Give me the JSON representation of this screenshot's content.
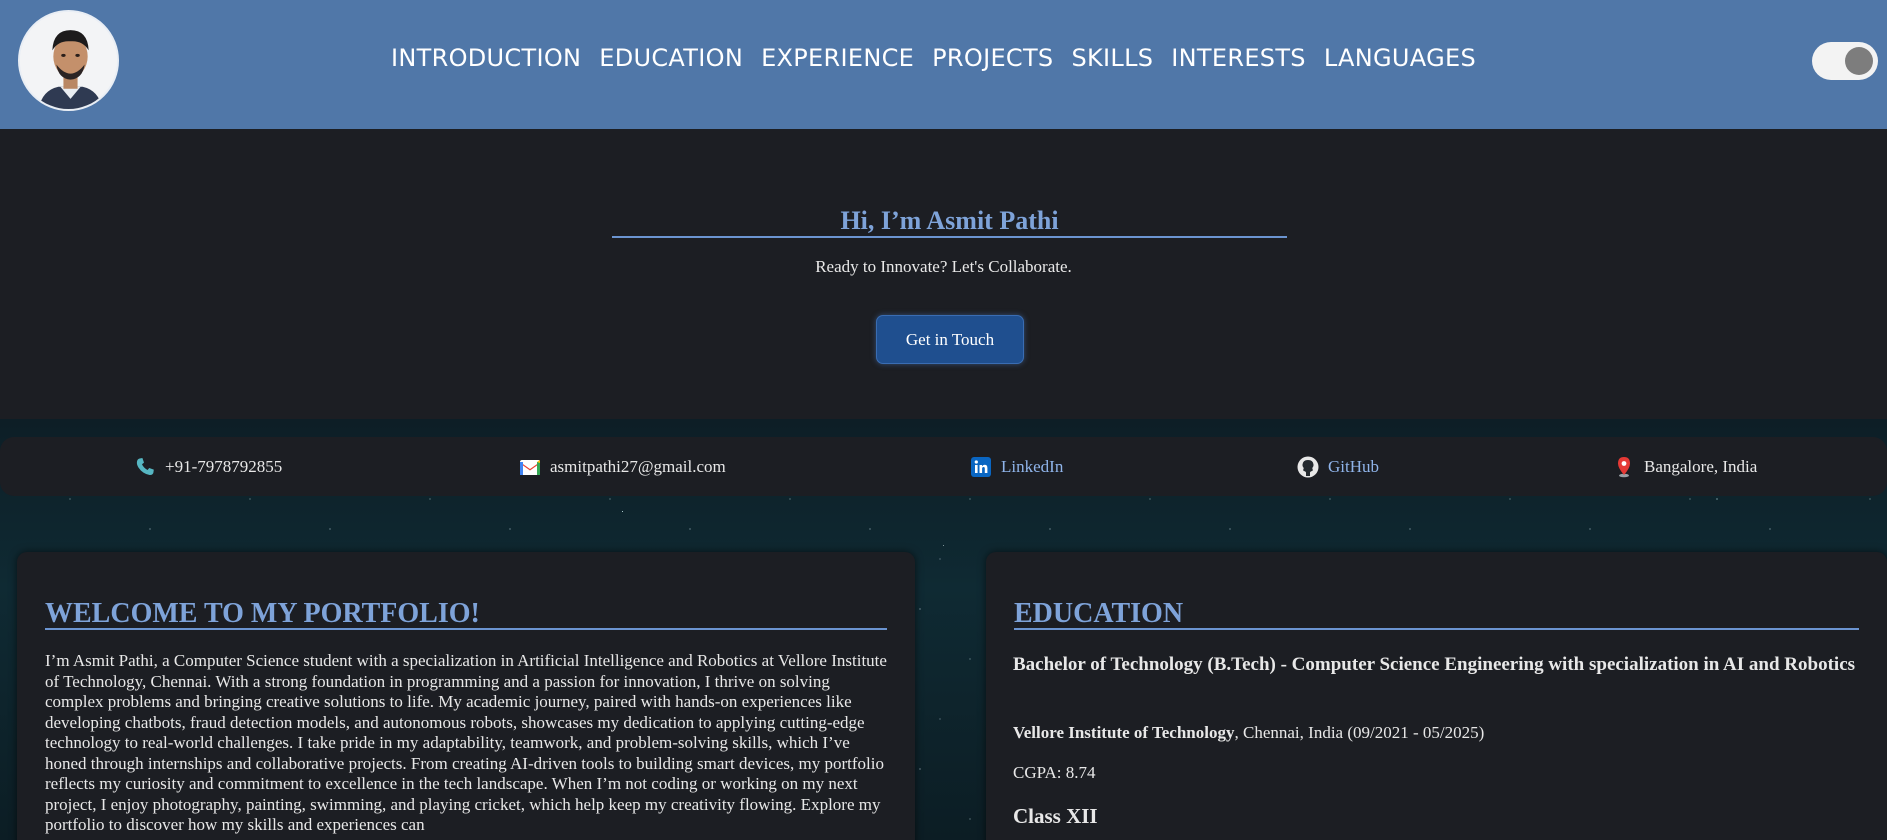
{
  "nav": {
    "items": [
      "INTRODUCTION",
      "EDUCATION",
      "EXPERIENCE",
      "PROJECTS",
      "SKILLS",
      "INTERESTS",
      "LANGUAGES"
    ]
  },
  "hero": {
    "title": "Hi, I’m Asmit Pathi",
    "subtitle": "Ready to Innovate? Let's Collaborate.",
    "cta_label": "Get in Touch"
  },
  "contacts": {
    "phone": "+91-7978792855",
    "email": "asmitpathi27@gmail.com",
    "linkedin": "LinkedIn",
    "github": "GitHub",
    "location": "Bangalore, India"
  },
  "intro": {
    "heading": "WELCOME TO MY PORTFOLIO!",
    "body": "I’m Asmit Pathi, a Computer Science student with a specialization in Artificial Intelligence and Robotics at Vellore Institute of Technology, Chennai. With a strong foundation in programming and a passion for innovation, I thrive on solving complex problems and bringing creative solutions to life. My academic journey, paired with hands-on experiences like developing chatbots, fraud detection models, and autonomous robots, showcases my dedication to applying cutting-edge technology to real-world challenges. I take pride in my adaptability, teamwork, and problem-solving skills, which I’ve honed through internships and collaborative projects. From creating AI-driven tools to building smart devices, my portfolio reflects my curiosity and commitment to excellence in the tech landscape. When I’m not coding or working on my next project, I enjoy photography, painting, swimming, and playing cricket, which help keep my creativity flowing. Explore my portfolio to discover how my skills and experiences can"
  },
  "education": {
    "heading": "EDUCATION",
    "degree": "Bachelor of Technology (B.Tech) - Computer Science Engineering with specialization in AI and Robotics",
    "institution": "Vellore Institute of Technology",
    "institution_details": ", Chennai, India (09/2021 - 05/2025)",
    "cgpa": "CGPA: 8.74",
    "next_heading": "Class XII"
  },
  "theme": {
    "header_bg": "#5077a8",
    "accent": "#7ea3d9",
    "button_bg": "#1f4f8f"
  }
}
